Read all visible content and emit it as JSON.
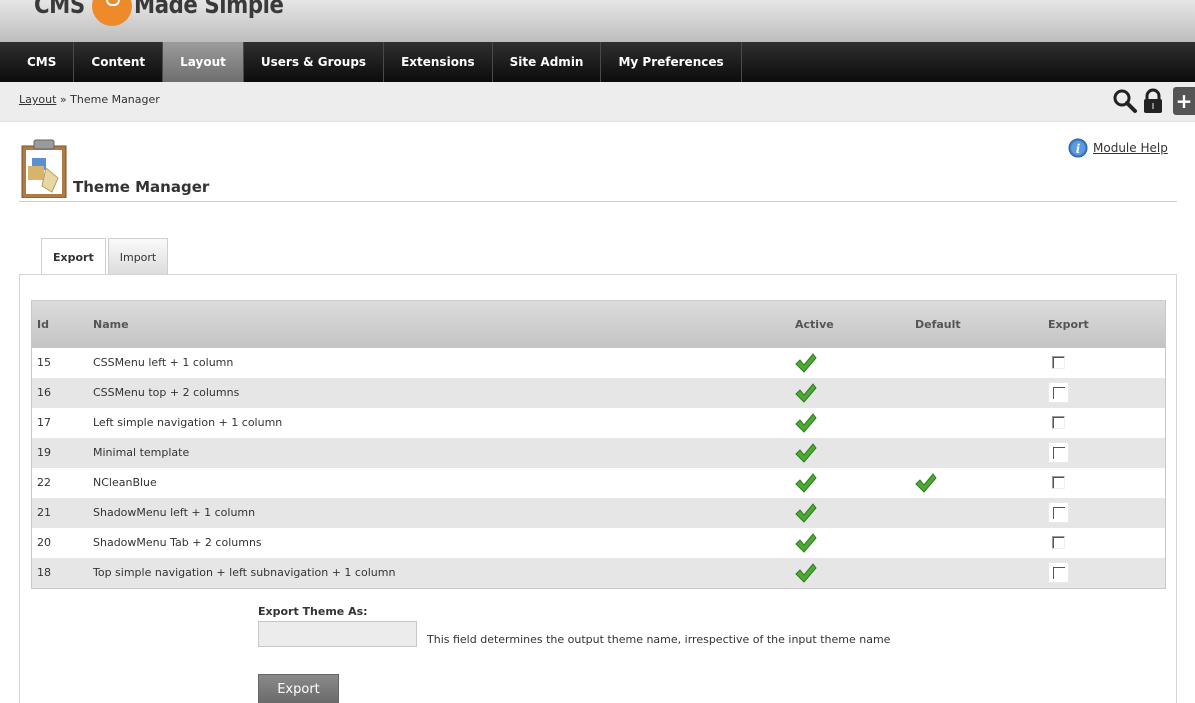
{
  "header": {
    "logo_text_left": "CMS",
    "logo_text_right": "Made Simple"
  },
  "nav": {
    "items": [
      {
        "label": "CMS"
      },
      {
        "label": "Content"
      },
      {
        "label": "Layout",
        "active": true
      },
      {
        "label": "Users & Groups"
      },
      {
        "label": "Extensions"
      },
      {
        "label": "Site Admin"
      },
      {
        "label": "My Preferences"
      }
    ]
  },
  "breadcrumb": {
    "parent": "Layout",
    "separator": "»",
    "current": "Theme Manager"
  },
  "toolbar": {
    "icons": [
      "search-icon",
      "lock-icon",
      "plus-icon"
    ],
    "plus_label": "+"
  },
  "page": {
    "title": "Theme Manager",
    "help_label": "Module Help"
  },
  "tabs": [
    {
      "label": "Export",
      "active": true
    },
    {
      "label": "Import",
      "active": false
    }
  ],
  "table": {
    "columns": {
      "id": "Id",
      "name": "Name",
      "active": "Active",
      "default": "Default",
      "export": "Export"
    },
    "rows": [
      {
        "id": "15",
        "name": "CSSMenu left + 1 column",
        "active": true,
        "default": false,
        "export": false
      },
      {
        "id": "16",
        "name": "CSSMenu top + 2 columns",
        "active": true,
        "default": false,
        "export": false
      },
      {
        "id": "17",
        "name": "Left simple navigation + 1 column",
        "active": true,
        "default": false,
        "export": false
      },
      {
        "id": "19",
        "name": "Minimal template",
        "active": true,
        "default": false,
        "export": false
      },
      {
        "id": "22",
        "name": "NCleanBlue",
        "active": true,
        "default": true,
        "export": false
      },
      {
        "id": "21",
        "name": "ShadowMenu left + 1 column",
        "active": true,
        "default": false,
        "export": false
      },
      {
        "id": "20",
        "name": "ShadowMenu Tab + 2 columns",
        "active": true,
        "default": false,
        "export": false
      },
      {
        "id": "18",
        "name": "Top simple navigation + left subnavigation + 1 column",
        "active": true,
        "default": false,
        "export": false
      }
    ]
  },
  "export_form": {
    "label": "Export Theme As:",
    "value": "",
    "hint": "This field determines the output theme name, irrespective of the input theme name",
    "button_label": "Export"
  },
  "colors": {
    "accent_orange": "#ee8a2a",
    "nav_dark": "#1a1a1a",
    "nav_active": "#8a8a8a",
    "check_green": "#3e9a2c"
  }
}
